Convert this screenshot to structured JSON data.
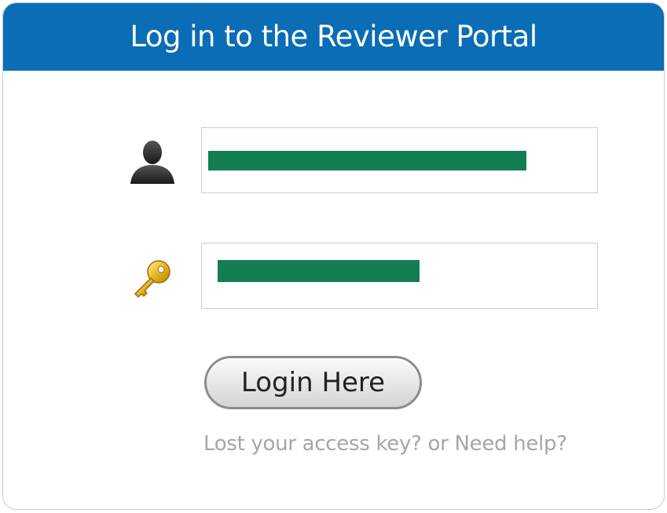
{
  "header": {
    "title": "Log in to the Reviewer Portal"
  },
  "form": {
    "username_value": "",
    "password_value": "",
    "user_icon": "user-icon",
    "key_icon": "key-icon",
    "login_label": "Login Here"
  },
  "help": {
    "lost_key": "Lost your access key?",
    "separator": "or",
    "need_help": "Need help?"
  },
  "colors": {
    "header_bg": "#0a6db5",
    "redaction": "#127e52",
    "help_text": "#a6a6a6"
  }
}
